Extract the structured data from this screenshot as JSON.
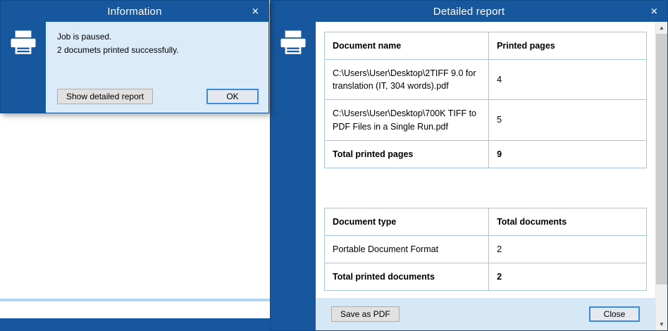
{
  "info_dialog": {
    "title": "Information",
    "message_line1": "Job is paused.",
    "message_line2": "2 documets printed successfully.",
    "buttons": {
      "detail": "Show detailed report",
      "ok": "OK"
    }
  },
  "report_dialog": {
    "title": "Detailed report",
    "pages_table": {
      "headers": [
        "Document name",
        "Printed pages"
      ],
      "rows": [
        {
          "name": "C:\\Users\\User\\Desktop\\2TIFF 9.0 for translation (IT, 304 words).pdf",
          "pages": "4"
        },
        {
          "name": "C:\\Users\\User\\Desktop\\700K TIFF to PDF Files in a Single Run.pdf",
          "pages": "5"
        }
      ],
      "total_label": "Total printed pages",
      "total_value": "9"
    },
    "types_table": {
      "headers": [
        "Document type",
        "Total documents"
      ],
      "rows": [
        {
          "type": "Portable Document Format",
          "count": "2"
        }
      ],
      "total_label": "Total printed documents",
      "total_value": "2"
    },
    "buttons": {
      "save": "Save as PDF",
      "close": "Close"
    }
  },
  "icons": {
    "close": "✕",
    "printer": "printer-icon",
    "scroll_up": "▲",
    "scroll_down": "▼"
  },
  "colors": {
    "titlebar": "#17579E",
    "info_dialog_bg": "#DCEBFA",
    "table_border": "#A6C5E2",
    "button_bg": "#E1E1E1",
    "button_border": "#ADADAD",
    "focus_border": "#3C8BE0",
    "bottom_bar": "#D6E7F5",
    "scroll_track": "#F0F0F0",
    "scroll_thumb": "#CDCDCD"
  }
}
